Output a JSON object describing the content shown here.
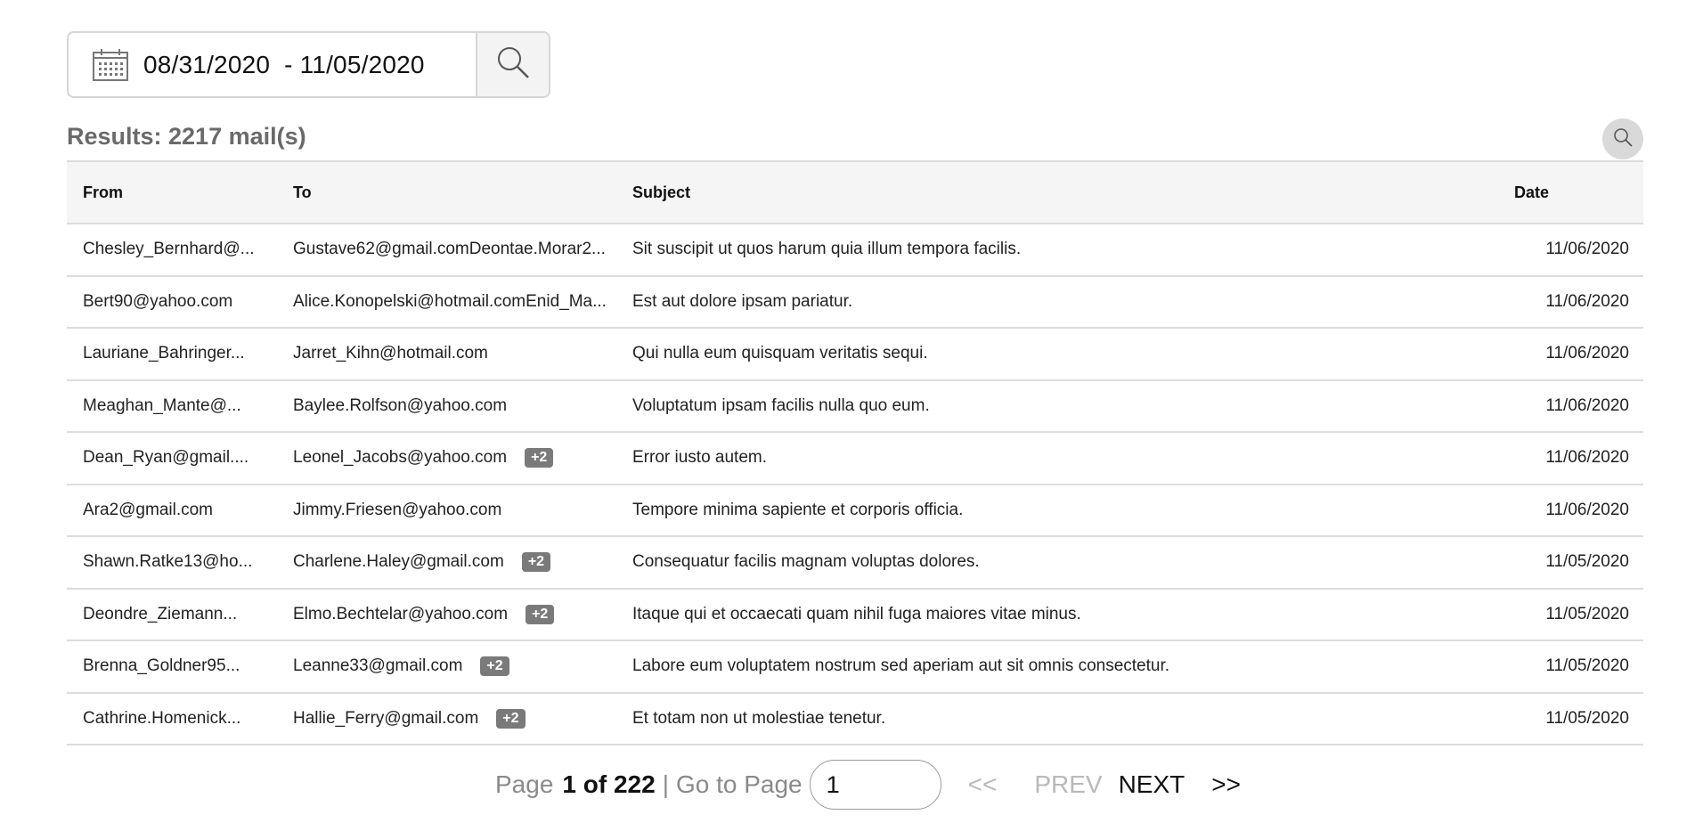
{
  "search": {
    "date_range": "08/31/2020  - 11/05/2020"
  },
  "results_label": "Results: 2217 mail(s)",
  "table": {
    "columns": [
      "From",
      "To",
      "Subject",
      "Date"
    ],
    "rows": [
      {
        "from": "Chesley_Bernhard@...",
        "to": "Gustave62@gmail.comDeontae.Morar2...",
        "badge": "",
        "subject": "Sit suscipit ut quos harum quia illum tempora facilis.",
        "date": "11/06/2020"
      },
      {
        "from": "Bert90@yahoo.com",
        "to": "Alice.Konopelski@hotmail.comEnid_Ma...",
        "badge": "",
        "subject": "Est aut dolore ipsam pariatur.",
        "date": "11/06/2020"
      },
      {
        "from": "Lauriane_Bahringer...",
        "to": "Jarret_Kihn@hotmail.com",
        "badge": "",
        "subject": "Qui nulla eum quisquam veritatis sequi.",
        "date": "11/06/2020"
      },
      {
        "from": "Meaghan_Mante@...",
        "to": "Baylee.Rolfson@yahoo.com",
        "badge": "",
        "subject": "Voluptatum ipsam facilis nulla quo eum.",
        "date": "11/06/2020"
      },
      {
        "from": "Dean_Ryan@gmail....",
        "to": "Leonel_Jacobs@yahoo.com",
        "badge": "+2",
        "subject": "Error iusto autem.",
        "date": "11/06/2020"
      },
      {
        "from": "Ara2@gmail.com",
        "to": "Jimmy.Friesen@yahoo.com",
        "badge": "",
        "subject": "Tempore minima sapiente et corporis officia.",
        "date": "11/06/2020"
      },
      {
        "from": "Shawn.Ratke13@ho...",
        "to": "Charlene.Haley@gmail.com",
        "badge": "+2",
        "subject": "Consequatur facilis magnam voluptas dolores.",
        "date": "11/05/2020"
      },
      {
        "from": "Deondre_Ziemann...",
        "to": "Elmo.Bechtelar@yahoo.com",
        "badge": "+2",
        "subject": "Itaque qui et occaecati quam nihil fuga maiores vitae minus.",
        "date": "11/05/2020"
      },
      {
        "from": "Brenna_Goldner95...",
        "to": "Leanne33@gmail.com",
        "badge": "+2",
        "subject": "Labore eum voluptatem nostrum sed aperiam aut sit omnis consectetur.",
        "date": "11/05/2020"
      },
      {
        "from": "Cathrine.Homenick...",
        "to": "Hallie_Ferry@gmail.com",
        "badge": "+2",
        "subject": "Et totam non ut molestiae tenetur.",
        "date": "11/05/2020"
      }
    ]
  },
  "pagination": {
    "page_prefix": "Page",
    "page_status": "1 of 222",
    "separator": "|",
    "goto_label": "Go to Page",
    "page_input_value": "1",
    "first_label": "<<",
    "prev_label": "PREV",
    "next_label": "NEXT",
    "last_label": ">>"
  },
  "icons": {
    "calendar": "calendar-icon",
    "search": "search-icon",
    "table_search": "search-icon"
  },
  "colors": {
    "header_bg": "#f5f5f5",
    "border": "#dcdcdc",
    "badge_bg": "#7a7a7a",
    "muted_text": "#8a8a8a"
  }
}
